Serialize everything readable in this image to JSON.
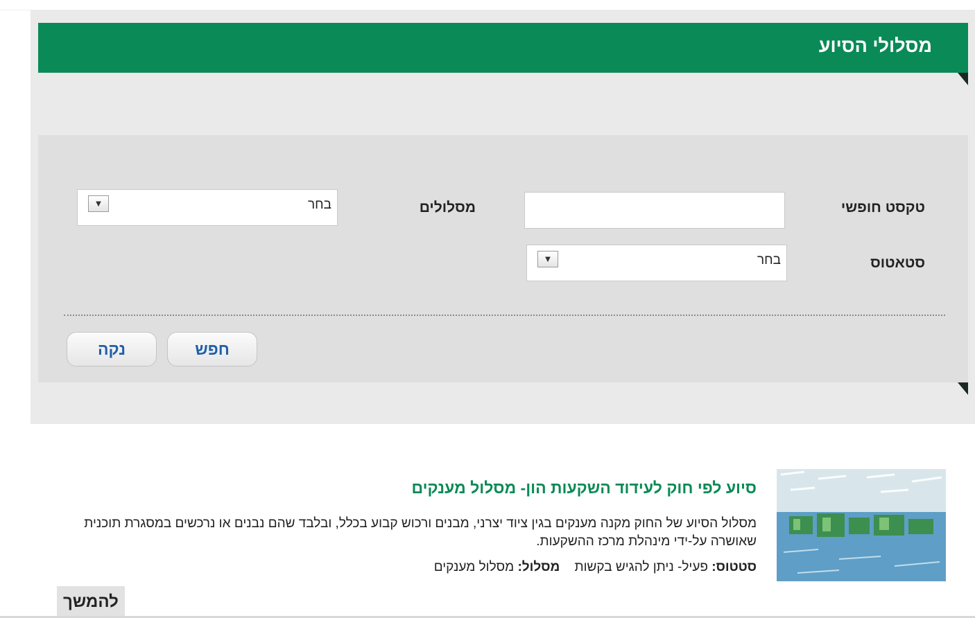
{
  "header": {
    "title": "מסלולי הסיוע"
  },
  "search_form": {
    "free_text": {
      "label": "טקסט חופשי",
      "value": ""
    },
    "tracks": {
      "label": "מסלולים",
      "selected": "בחר"
    },
    "status": {
      "label": "סטאטוס",
      "selected": "בחר"
    },
    "search_button": "חפש",
    "clear_button": "נקה"
  },
  "results": [
    {
      "image_icon": "factory-photo",
      "title": "סיוע לפי חוק לעידוד השקעות הון- מסלול מענקים",
      "description": "מסלול הסיוע של החוק מקנה מענקים בגין ציוד יצרני, מבנים ורכוש קבוע בכלל, ובלבד שהם נבנים או נרכשים במסגרת תוכנית שאושרה על-ידי מינהלת מרכז ההשקעות.",
      "status_label": "סטטוס:",
      "status_value": "פעיל- ניתן להגיש בקשות",
      "track_label": "מסלול:",
      "track_value": "מסלול מענקים",
      "more_label": "להמשך"
    }
  ],
  "colors": {
    "brand_green": "#0a8a57",
    "button_text": "#1f5fa8"
  }
}
